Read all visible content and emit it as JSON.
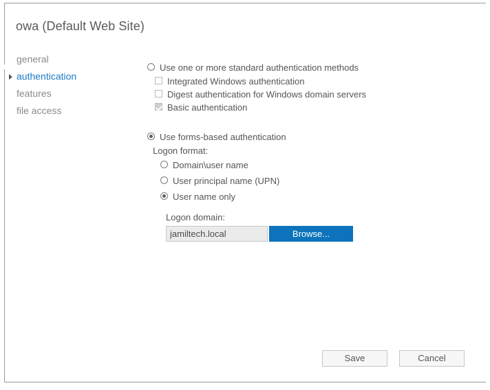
{
  "dialog": {
    "title": "owa (Default Web Site)"
  },
  "sidebar": {
    "items": [
      {
        "label": "general",
        "active": false
      },
      {
        "label": "authentication",
        "active": true
      },
      {
        "label": "features",
        "active": false
      },
      {
        "label": "file access",
        "active": false
      }
    ]
  },
  "authentication": {
    "standard": {
      "label": "Use one or more standard authentication methods",
      "selected": false,
      "methods": [
        {
          "label": "Integrated Windows authentication",
          "checked": false
        },
        {
          "label": "Digest authentication for Windows domain servers",
          "checked": false
        },
        {
          "label": "Basic authentication",
          "checked": true
        }
      ]
    },
    "forms_based": {
      "label": "Use forms-based authentication",
      "selected": true,
      "logon_format_label": "Logon format:",
      "formats": [
        {
          "label": "Domain\\user name",
          "selected": false
        },
        {
          "label": "User principal name (UPN)",
          "selected": false
        },
        {
          "label": "User name only",
          "selected": true
        }
      ],
      "logon_domain_label": "Logon domain:",
      "logon_domain_value": "jamiltech.local",
      "browse_label": "Browse..."
    }
  },
  "footer": {
    "save_label": "Save",
    "cancel_label": "Cancel"
  },
  "colors": {
    "accent_blue": "#0d74bb",
    "active_nav": "#1b7ac2",
    "text": "#555555",
    "muted_text": "#8a8a8a"
  }
}
